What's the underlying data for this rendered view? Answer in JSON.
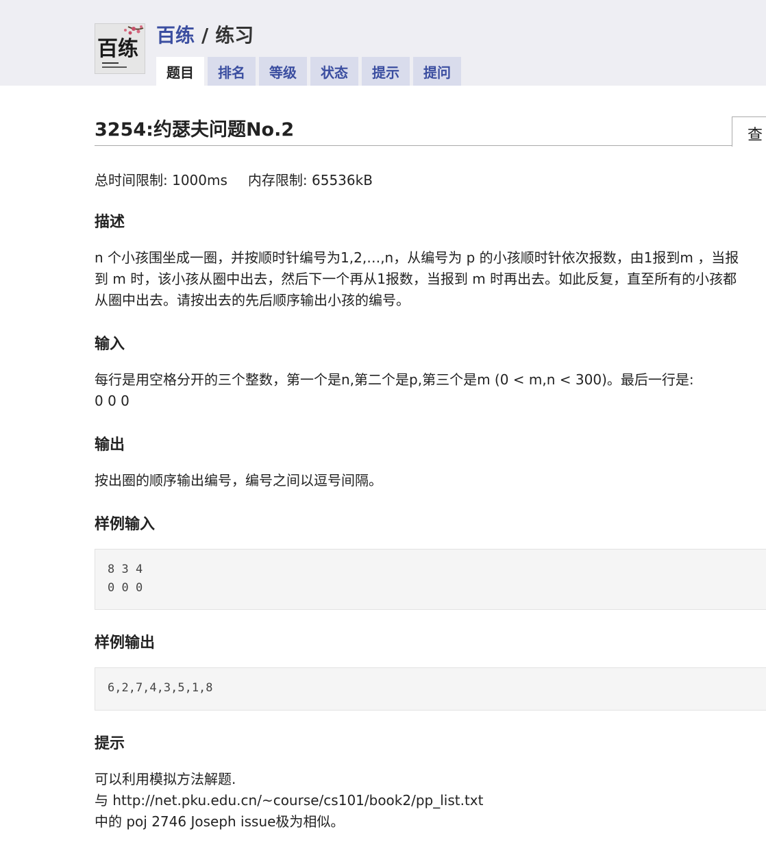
{
  "header": {
    "logo_text": "百练",
    "brand": "百练",
    "separator": "/",
    "section": "练习",
    "tabs": [
      {
        "label": "题目",
        "active": true
      },
      {
        "label": "排名",
        "active": false
      },
      {
        "label": "等级",
        "active": false
      },
      {
        "label": "状态",
        "active": false
      },
      {
        "label": "提示",
        "active": false
      },
      {
        "label": "提问",
        "active": false
      }
    ]
  },
  "problem": {
    "title": "3254:约瑟夫问题No.2",
    "view_tab": "查",
    "time_limit": "总时间限制: 1000ms",
    "memory_limit": "内存限制: 65536kB",
    "description_heading": "描述",
    "description_lines": [
      "n 个小孩围坐成一圈，并按顺时针编号为1,2,…,n，从编号为 p 的小孩顺时针依次报数，由1报到m ，当报",
      "到 m 时，该小孩从圈中出去，然后下一个再从1报数，当报到 m 时再出去。如此反复，直至所有的小孩都",
      "从圈中出去。请按出去的先后顺序输出小孩的编号。"
    ],
    "input_heading": "输入",
    "input_lines": [
      "每行是用空格分开的三个整数，第一个是n,第二个是p,第三个是m (0 < m,n < 300)。最后一行是:",
      "0 0 0"
    ],
    "output_heading": "输出",
    "output_text": "按出圈的顺序输出编号，编号之间以逗号间隔。",
    "sample_input_heading": "样例输入",
    "sample_input": "8 3 4\n0 0 0",
    "sample_output_heading": "样例输出",
    "sample_output": "6,2,7,4,3,5,1,8",
    "hint_heading": "提示",
    "hint_lines": [
      "可以利用模拟方法解题.",
      "与 http://net.pku.edu.cn/~course/cs101/book2/pp_list.txt",
      "中的 poj 2746 Joseph issue极为相似。"
    ]
  }
}
